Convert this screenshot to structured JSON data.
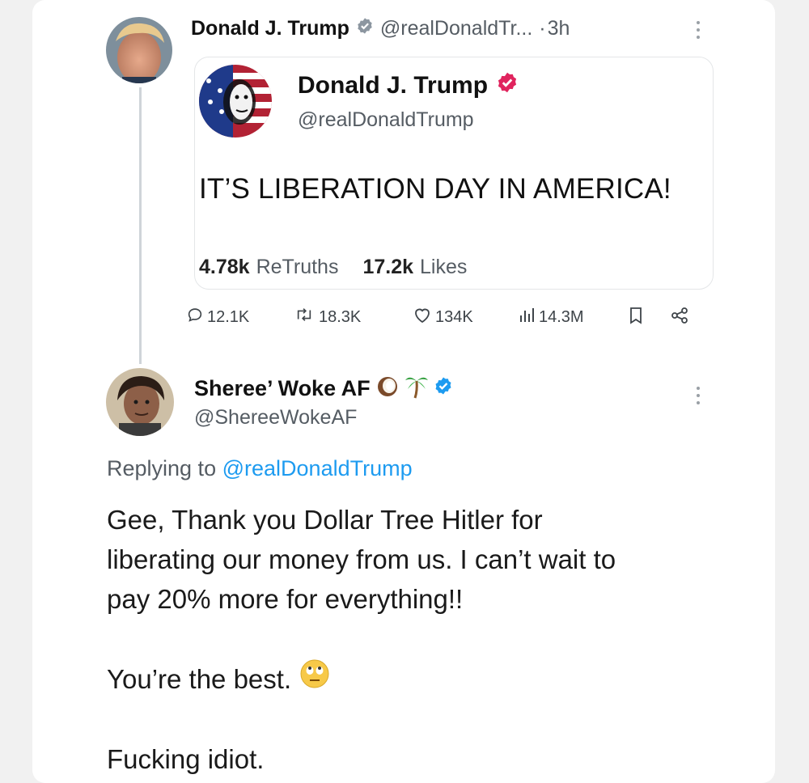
{
  "post": {
    "author_name": "Donald J. Trump",
    "handle": "@realDonaldTr...",
    "dot": "·",
    "time": "3h"
  },
  "quote": {
    "author_name": "Donald J. Trump",
    "handle": "@realDonaldTrump",
    "text": "IT’S LIBERATION DAY IN AMERICA!",
    "retruths_count": "4.78k",
    "retruths_label": "ReTruths",
    "likes_count": "17.2k",
    "likes_label": "Likes"
  },
  "actions": {
    "replies": "12.1K",
    "reposts": "18.3K",
    "likes": "134K",
    "views": "14.3M"
  },
  "reply": {
    "author_name": "Sheree’ Woke AF",
    "handle": "@ShereeWokeAF",
    "replying_prefix": "Replying to",
    "replying_handle": "@realDonaldTrump",
    "line1": "Gee, Thank you Dollar Tree Hitler for",
    "line2": "liberating our money from us. I can’t wait to",
    "line3": "pay 20% more for everything!!",
    "line4": "You’re the best.",
    "line5": "Fucking idiot."
  },
  "icons": {
    "verified": "verified-badge-icon",
    "verified_red": "verified-red-badge-icon",
    "reply": "reply-icon",
    "repost": "repost-icon",
    "like": "heart-icon",
    "views": "views-icon",
    "bookmark": "bookmark-icon",
    "share": "share-icon",
    "more": "more-vertical-icon",
    "coconut": "coconut-emoji-icon",
    "palm": "palm-tree-emoji-icon",
    "eyeroll": "eye-roll-emoji-icon"
  },
  "colors": {
    "link": "#1d9bf0",
    "verified_blue": "#1d9bf0",
    "verified_red": "#e0245e",
    "text": "#111111",
    "muted": "#555c63"
  }
}
